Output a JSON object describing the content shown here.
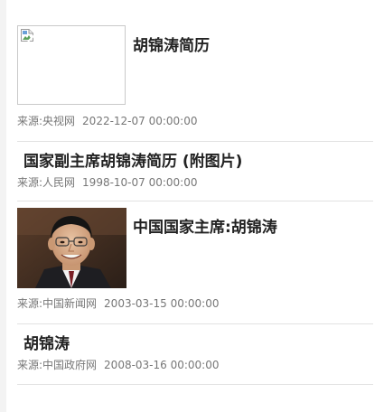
{
  "articles": [
    {
      "title": "胡锦涛简历",
      "source": "来源:央视网",
      "date": "2022-12-07 00:00:00",
      "thumbnail": "broken-image-icon"
    },
    {
      "title": "国家副主席胡锦涛简历 (附图片)",
      "source": "来源:人民网",
      "date": "1998-10-07 00:00:00"
    },
    {
      "title": "中国国家主席:胡锦涛",
      "source": "来源:中国新闻网",
      "date": "2003-03-15 00:00:00",
      "thumbnail": "portrait-photo"
    },
    {
      "title": "胡锦涛",
      "source": "来源:中国政府网",
      "date": "2008-03-16 00:00:00"
    }
  ],
  "colors": {
    "title": "#222222",
    "meta": "#777777",
    "divider": "#e2e2e2"
  }
}
